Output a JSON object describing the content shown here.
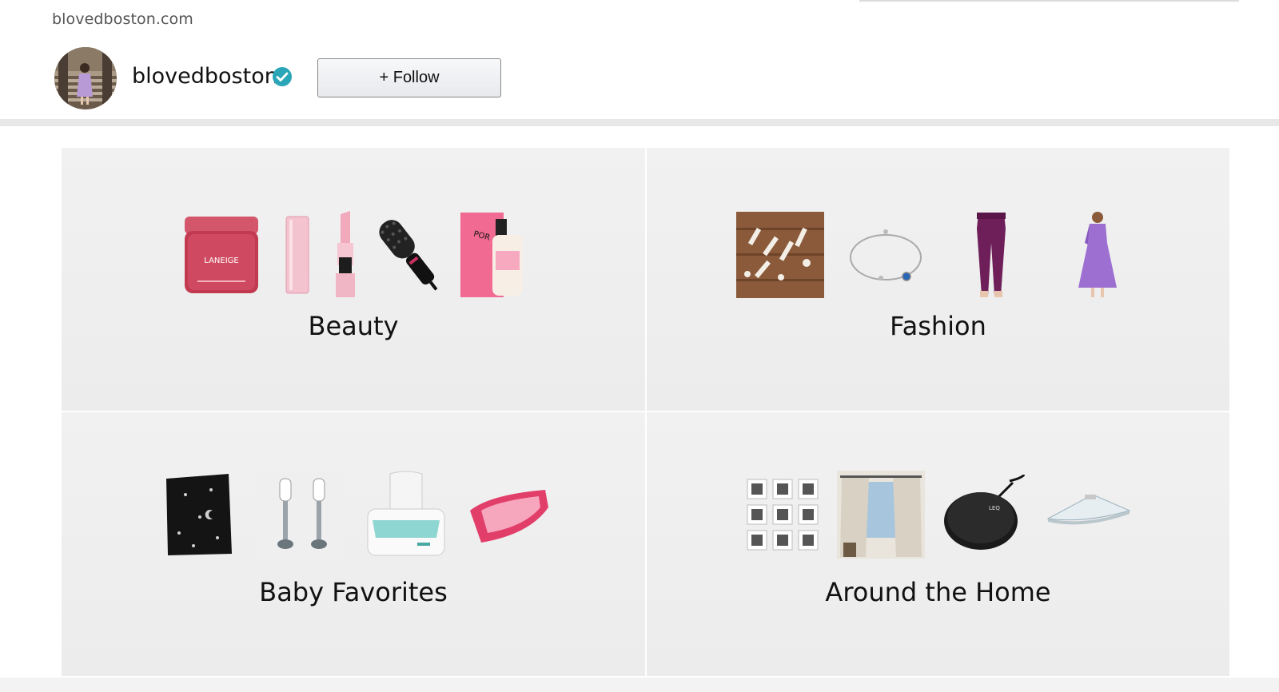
{
  "header": {
    "site_url": "blovedboston.com",
    "username": "blovedboston",
    "follow_label": "+ Follow",
    "verified_color": "#2aa6b8"
  },
  "categories": [
    {
      "title": "Beauty",
      "items": [
        "lip-mask-jar-icon",
        "lip-tint-tube-icon",
        "lipstick-icon",
        "hair-dryer-brush-icon",
        "pore-primer-bottle-icon"
      ]
    },
    {
      "title": "Fashion",
      "items": [
        "hair-clips-photo-icon",
        "bracelet-icon",
        "leggings-icon",
        "purple-dress-icon"
      ]
    },
    {
      "title": "Baby Favorites",
      "items": [
        "black-star-bag-icon",
        "bottle-brushes-icon",
        "wipe-warmer-icon",
        "baby-bath-tub-icon"
      ]
    },
    {
      "title": "Around the Home",
      "items": [
        "photo-frame-set-icon",
        "curtains-icon",
        "wireless-charger-icon",
        "corner-shelf-icon"
      ]
    }
  ]
}
